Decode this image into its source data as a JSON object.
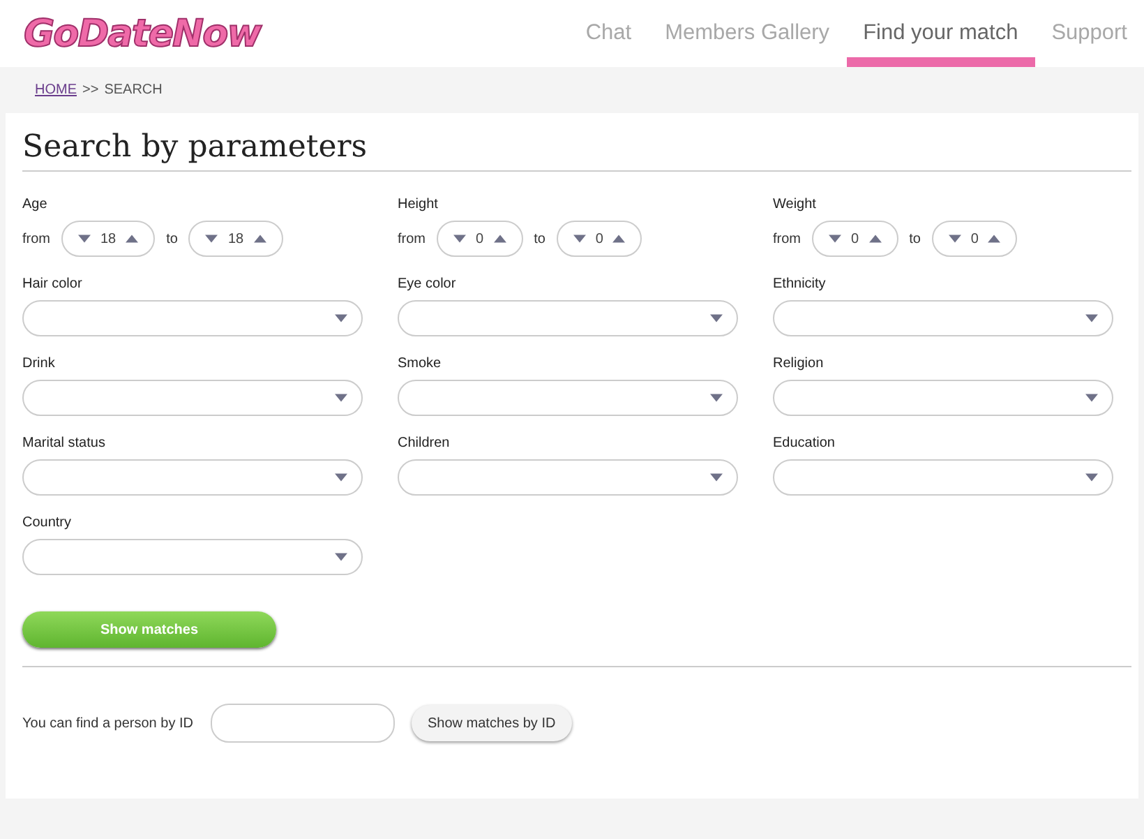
{
  "logo": "GoDateNow",
  "nav": [
    {
      "label": "Chat",
      "selected": false
    },
    {
      "label": "Members Gallery",
      "selected": false
    },
    {
      "label": "Find your match",
      "selected": true
    },
    {
      "label": "Support",
      "selected": false
    }
  ],
  "breadcrumb": {
    "home": "HOME",
    "separator": ">>",
    "current": "SEARCH"
  },
  "heading": "Search by parameters",
  "fields": [
    {
      "kind": "range",
      "label": "Age",
      "from_label": "from",
      "from": "18",
      "to_label": "to",
      "to": "18"
    },
    {
      "kind": "range",
      "label": "Height",
      "from_label": "from",
      "from": "0",
      "to_label": "to",
      "to": "0"
    },
    {
      "kind": "range",
      "label": "Weight",
      "from_label": "from",
      "from": "0",
      "to_label": "to",
      "to": "0"
    },
    {
      "kind": "select",
      "label": "Hair color"
    },
    {
      "kind": "select",
      "label": "Eye color"
    },
    {
      "kind": "select",
      "label": "Ethnicity"
    },
    {
      "kind": "select",
      "label": "Drink"
    },
    {
      "kind": "select",
      "label": "Smoke"
    },
    {
      "kind": "select",
      "label": "Religion"
    },
    {
      "kind": "select",
      "label": "Marital status"
    },
    {
      "kind": "select",
      "label": "Children"
    },
    {
      "kind": "select",
      "label": "Education"
    },
    {
      "kind": "select",
      "label": "Country"
    }
  ],
  "submit": "Show matches",
  "id_search": {
    "label": "You can find a person by ID",
    "button": "Show matches by ID"
  }
}
